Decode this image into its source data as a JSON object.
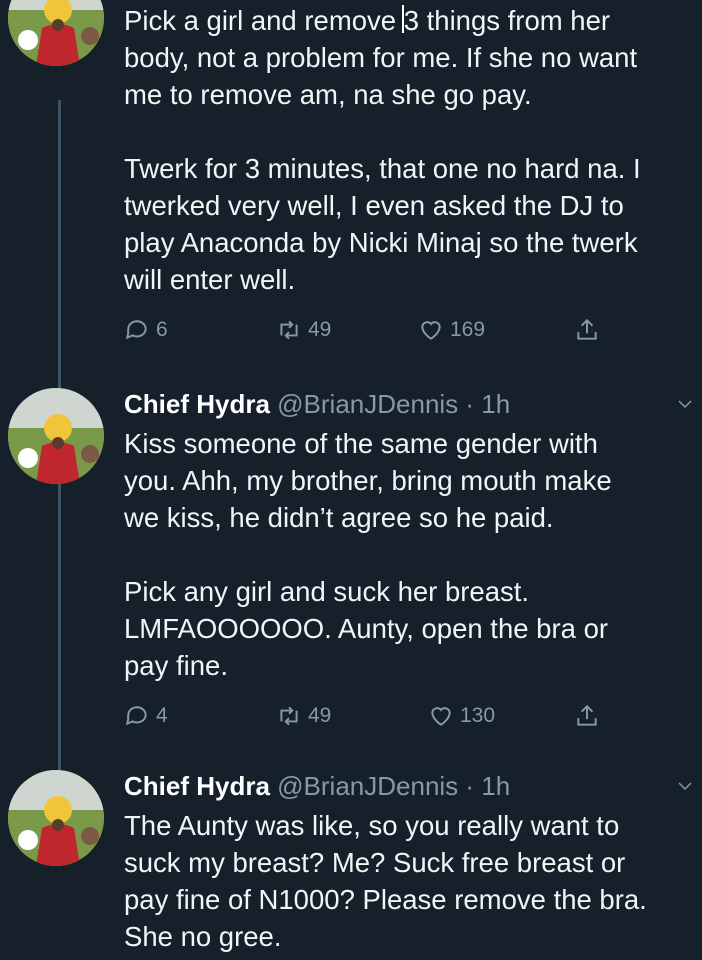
{
  "tweets": [
    {
      "author_name": "",
      "handle": "",
      "time": "",
      "paragraphs": [
        "Pick a girl and remove 3 things from her body, not a problem for me. If she no want me to remove am, na she go pay.",
        "Twerk for 3 minutes, that one no hard na. I twerked very well, I even asked the DJ to play Anaconda by Nicki Minaj so the twerk will enter well."
      ],
      "text": "Pick a girl and remove 3 things from her\nbody, not a problem for me. If she no want\nme to remove am, na she go pay.\n\nTwerk for 3 minutes, that one no hard na. I\ntwerked very well, I even asked the DJ to\nplay Anaconda by Nicki Minaj so the twerk\nwill enter well.",
      "replies": "6",
      "retweets": "49",
      "likes": "169"
    },
    {
      "author_name": "Chief Hydra",
      "handle": "@BrianJDennis · 1h",
      "text": "Kiss someone of the same gender with\nyou. Ahh, my brother, bring mouth make\nwe kiss, he didn’t agree so he paid.\n\nPick any girl and suck her breast.\nLMFAOOOOOO. Aunty, open the bra or\npay fine.",
      "replies": "4",
      "retweets": "49",
      "likes": "130"
    },
    {
      "author_name": "Chief Hydra",
      "handle": "@BrianJDennis · 1h",
      "text": "The Aunty was like, so you really want to\nsuck my breast? Me? Suck free breast or\npay fine of N1000? Please remove the bra.\nShe no gree."
    }
  ],
  "icons": {
    "reply": "reply-icon",
    "retweet": "retweet-icon",
    "like": "heart-icon",
    "share": "share-icon",
    "more": "chevron-down-icon"
  },
  "colors": {
    "background": "#15202b",
    "secondary_text": "#8899a6",
    "thread_line": "#3d5466"
  }
}
